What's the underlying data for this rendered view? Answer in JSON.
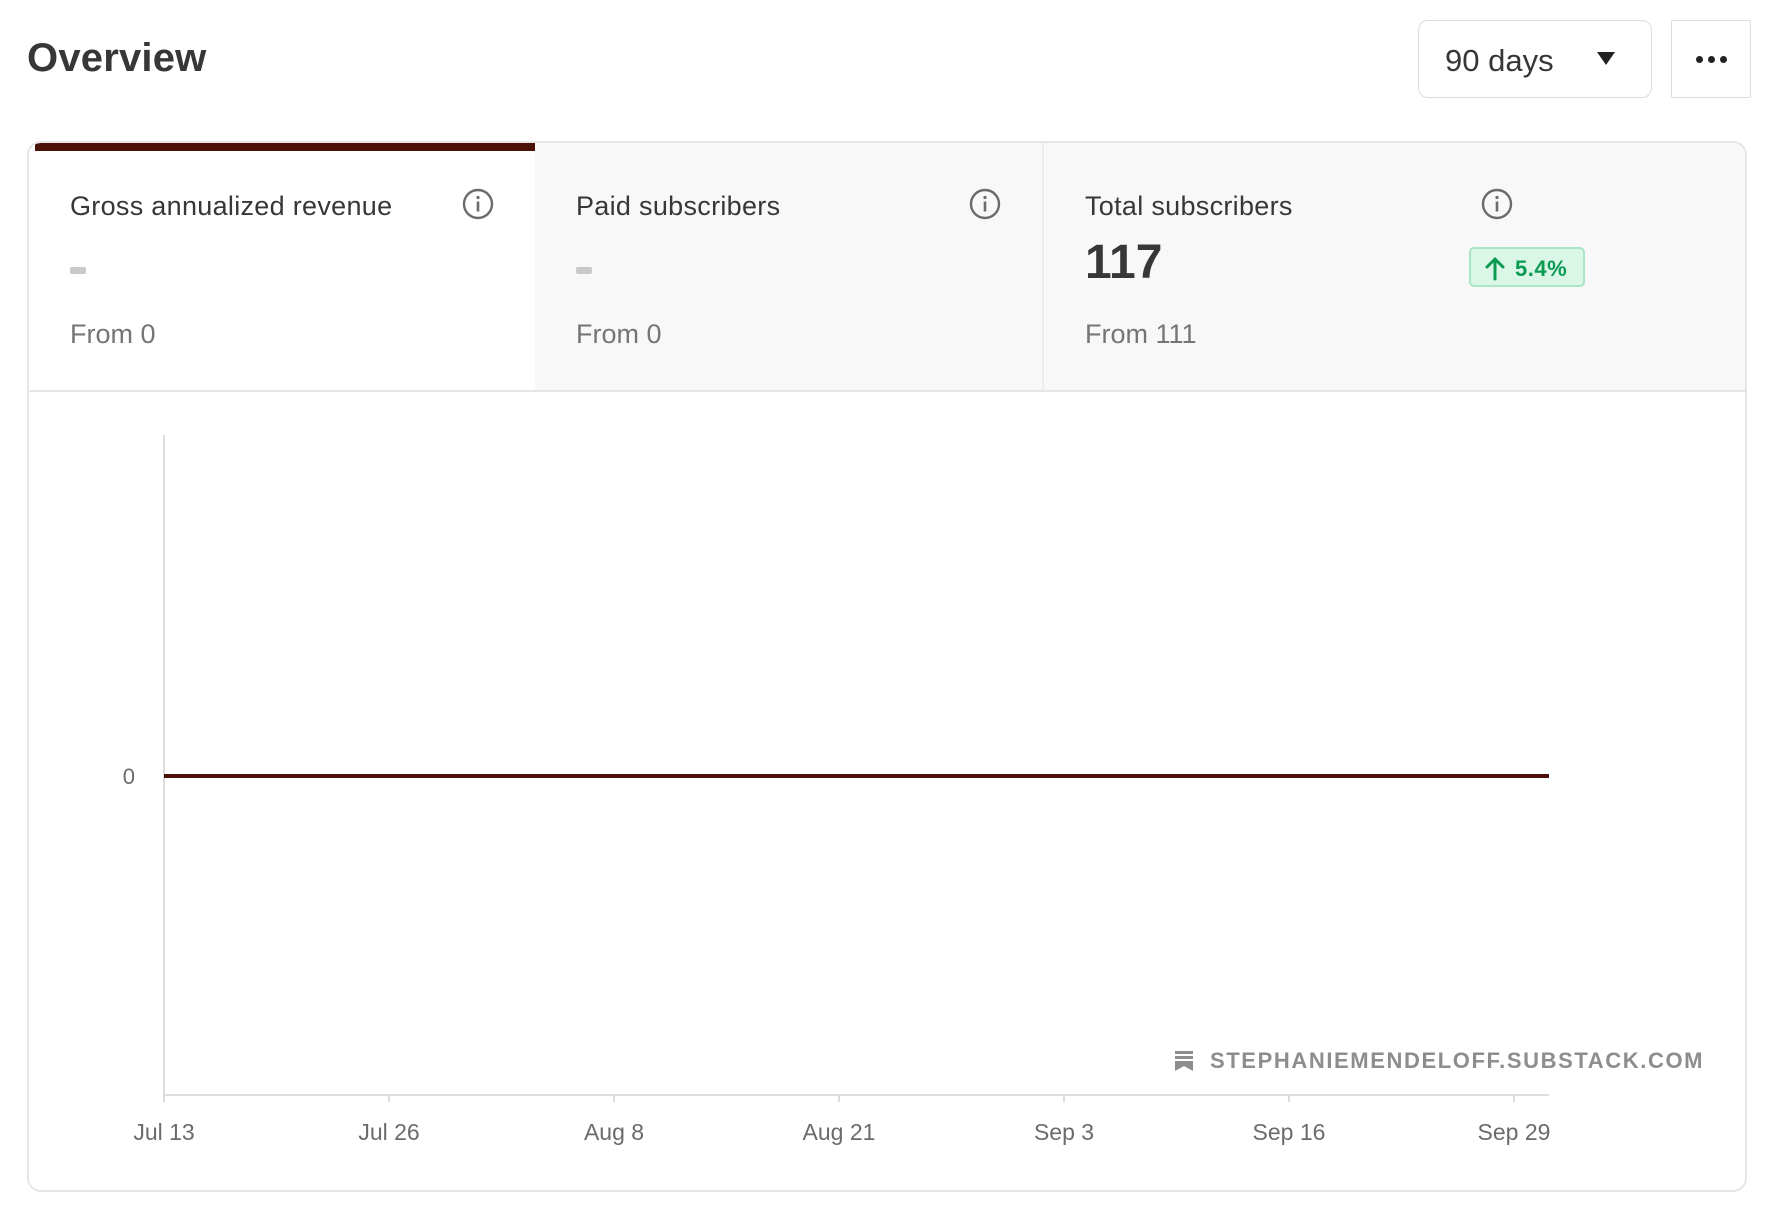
{
  "header": {
    "title": "Overview",
    "range": {
      "selected": "90 days",
      "icon": "chevron-down-icon"
    },
    "more_icon": "ellipsis-icon"
  },
  "metrics": [
    {
      "label": "Gross annualized revenue",
      "value": "-",
      "from": "From 0",
      "active": true
    },
    {
      "label": "Paid subscribers",
      "value": "-",
      "from": "From 0",
      "active": false
    },
    {
      "label": "Total subscribers",
      "value": "117",
      "from": "From 111",
      "active": false,
      "change": "5.4%",
      "change_direction": "up"
    }
  ],
  "colors": {
    "accent": "#4a1208",
    "positive_text": "#0a9a52",
    "positive_bg": "#d9f6e6",
    "positive_border": "#a8e6c4"
  },
  "chart_data": {
    "type": "line",
    "x": [
      "Jul 13",
      "Jul 26",
      "Aug 8",
      "Aug 21",
      "Sep 3",
      "Sep 16",
      "Sep 29"
    ],
    "series": [
      {
        "values": [
          0,
          0,
          0,
          0,
          0,
          0,
          0
        ]
      }
    ],
    "yticks": [
      "0"
    ],
    "grid": false
  },
  "watermark": {
    "text": "STEPHANIEMENDELOFF.SUBSTACK.COM",
    "icon": "bookmark-icon"
  }
}
